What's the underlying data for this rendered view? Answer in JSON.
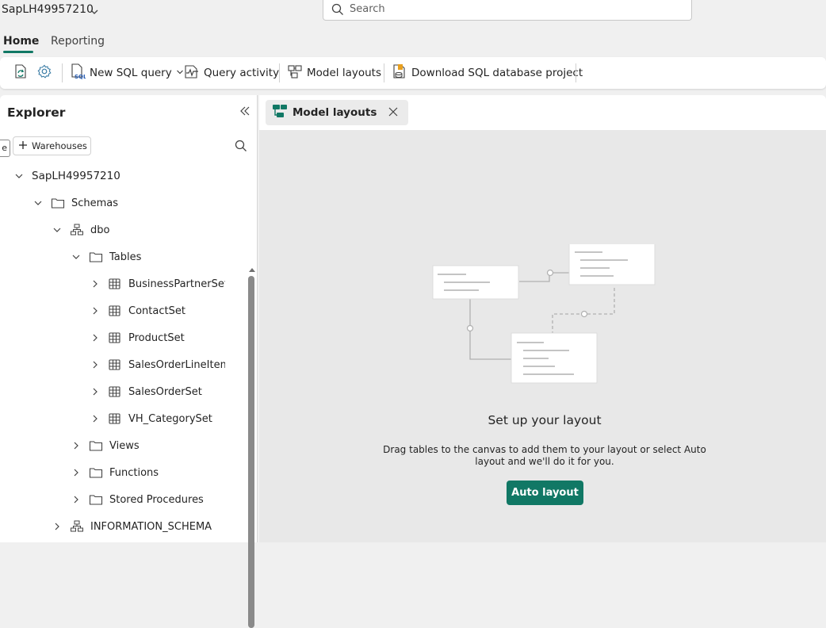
{
  "app": {
    "title": "SapLH49957210"
  },
  "search": {
    "placeholder": "Search"
  },
  "ribbon": {
    "tabs": [
      "Home",
      "Reporting"
    ],
    "active_tab": "Home"
  },
  "toolbar": {
    "new_sql_query": "New SQL query",
    "query_activity": "Query activity",
    "model_layouts": "Model layouts",
    "download_project": "Download SQL database project"
  },
  "explorer": {
    "title": "Explorer",
    "partial_chip": "e",
    "warehouses_button": "Warehouses",
    "tree": [
      {
        "label": "SapLH49957210",
        "level": 0,
        "state": "expanded",
        "icon": "none",
        "bold": true
      },
      {
        "label": "Schemas",
        "level": 1,
        "state": "expanded",
        "icon": "folder-icon"
      },
      {
        "label": "dbo",
        "level": 2,
        "state": "expanded",
        "icon": "schema-icon"
      },
      {
        "label": "Tables",
        "level": 3,
        "state": "expanded",
        "icon": "folder-icon"
      },
      {
        "label": "BusinessPartnerSet",
        "level": 4,
        "state": "collapsed",
        "icon": "table-icon"
      },
      {
        "label": "ContactSet",
        "level": 4,
        "state": "collapsed",
        "icon": "table-icon"
      },
      {
        "label": "ProductSet",
        "level": 4,
        "state": "collapsed",
        "icon": "table-icon"
      },
      {
        "label": "SalesOrderLineItemSet",
        "level": 4,
        "state": "collapsed",
        "icon": "table-icon"
      },
      {
        "label": "SalesOrderSet",
        "level": 4,
        "state": "collapsed",
        "icon": "table-icon"
      },
      {
        "label": "VH_CategorySet",
        "level": 4,
        "state": "collapsed",
        "icon": "table-icon"
      },
      {
        "label": "Views",
        "level": 3,
        "state": "collapsed",
        "icon": "folder-icon"
      },
      {
        "label": "Functions",
        "level": 3,
        "state": "collapsed",
        "icon": "folder-icon"
      },
      {
        "label": "Stored Procedures",
        "level": 3,
        "state": "collapsed",
        "icon": "folder-icon"
      },
      {
        "label": "INFORMATION_SCHEMA",
        "level": 2,
        "state": "collapsed",
        "icon": "schema-icon"
      }
    ]
  },
  "document_tab": {
    "label": "Model layouts"
  },
  "canvas": {
    "title": "Set up your layout",
    "description": "Drag tables to the canvas to add them to your layout or select Auto layout and we'll do it for you.",
    "button": "Auto layout"
  },
  "colors": {
    "accent": "#117865",
    "canvas": "#e8e8e8"
  }
}
